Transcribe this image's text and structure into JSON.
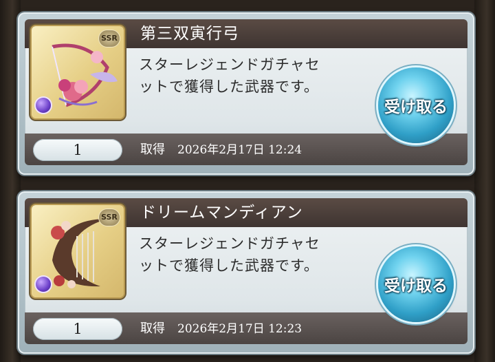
{
  "items": [
    {
      "title": "第三双寅行弓",
      "rarity": "SSR",
      "description_line1": "スターレジェンドガチャセ",
      "description_line2": "ットで獲得した武器です。",
      "button_label": "受け取る",
      "quantity": "1",
      "acquired_label": "取得",
      "acquired_date": "2026年2月17日 12:24",
      "icon": "bow-weapon-icon"
    },
    {
      "title": "ドリームマンディアン",
      "rarity": "SSR",
      "description_line1": "スターレジェンドガチャセ",
      "description_line2": "ットで獲得した武器です。",
      "button_label": "受け取る",
      "quantity": "1",
      "acquired_label": "取得",
      "acquired_date": "2026年2月17日 12:23",
      "icon": "harp-weapon-icon"
    }
  ],
  "colors": {
    "title_bar": "#4b3f3a",
    "button": "#2f9fc7",
    "card": "#dfe6e9"
  }
}
